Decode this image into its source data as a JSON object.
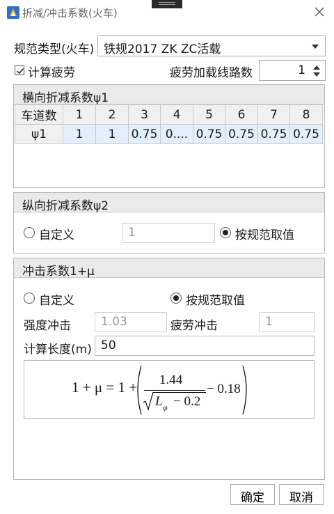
{
  "window": {
    "title": "折减/冲击系数(火车)",
    "icon": "app-logo-icon"
  },
  "spec_type": {
    "label": "规范类型(火车)",
    "value": "铁规2017 ZK ZC活载"
  },
  "fatigue_check": {
    "label": "计算疲劳",
    "checked": true
  },
  "fatigue_lines": {
    "label": "疲劳加载线路数",
    "value": "1"
  },
  "lateral": {
    "title": "横向折减系数ψ1",
    "header": [
      "车道数",
      "1",
      "2",
      "3",
      "4",
      "5",
      "6",
      "7",
      "8"
    ],
    "row": [
      "ψ1",
      "1",
      "1",
      "0.75",
      "0....",
      "0.75",
      "0.75",
      "0.75",
      "0.75"
    ]
  },
  "longitudinal": {
    "title": "纵向折减系数ψ2",
    "custom_label": "自定义",
    "custom_value": "1",
    "spec_label": "按规范取值",
    "selected": "spec"
  },
  "impact": {
    "title": "冲击系数1+μ",
    "custom_label": "自定义",
    "spec_label": "按规范取值",
    "selected": "spec",
    "strength_label": "强度冲击",
    "strength_value": "1.03",
    "fatigue_label": "疲劳冲击",
    "fatigue_value": "1",
    "length_label": "计算长度(m)",
    "length_value": "50",
    "formula": {
      "lhs": "1 + μ = 1 +",
      "numerator": "1.44",
      "radicand_var": "L",
      "radicand_sub": "φ",
      "radicand_rest": "− 0.2",
      "tail": "− 0.18"
    }
  },
  "buttons": {
    "ok": "确定",
    "cancel": "取消"
  }
}
